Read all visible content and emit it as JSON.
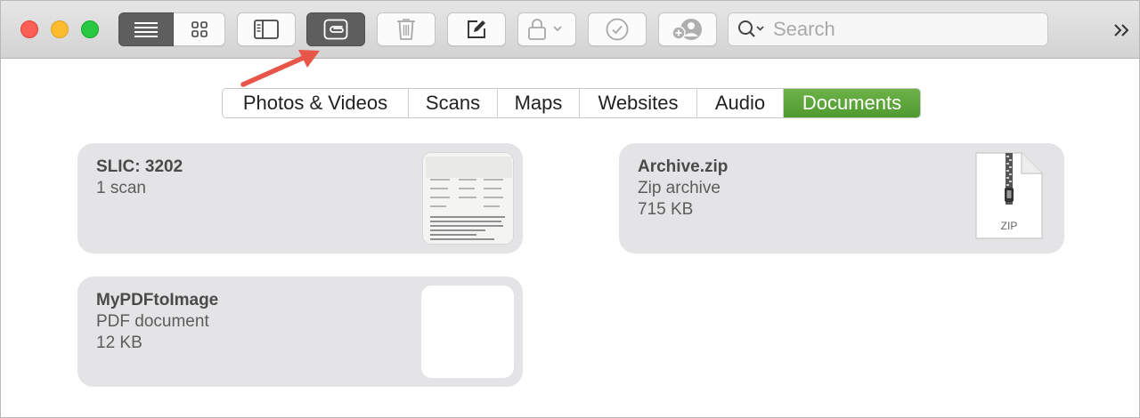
{
  "toolbar": {
    "view_buttons": [
      {
        "name": "list-view-button",
        "icon": "list-icon",
        "active": true
      },
      {
        "name": "grid-view-button",
        "icon": "grid-icon",
        "active": false
      }
    ],
    "sidebar_button_icon": "sidebar-icon",
    "attachments_button_icon": "paperclip-icon",
    "delete_button_icon": "trash-icon",
    "compose_button_icon": "compose-icon",
    "lock_button_icon": "lock-icon",
    "checklist_button_icon": "checkmark-circle-icon",
    "collaborate_button_icon": "add-person-icon",
    "search": {
      "placeholder": "Search",
      "value": ""
    },
    "overflow_label": "»"
  },
  "tabs": [
    {
      "label": "Photos & Videos",
      "active": false
    },
    {
      "label": "Scans",
      "active": false
    },
    {
      "label": "Maps",
      "active": false
    },
    {
      "label": "Websites",
      "active": false
    },
    {
      "label": "Audio",
      "active": false
    },
    {
      "label": "Documents",
      "active": true
    }
  ],
  "cards": [
    {
      "title": "SLIC: 3202",
      "line1": "1 scan",
      "line2": "",
      "thumbnail": "scan"
    },
    {
      "title": "Archive.zip",
      "line1": "Zip archive",
      "line2": "715 KB",
      "thumbnail": "zip",
      "thumb_label": "ZIP"
    },
    {
      "title": "MyPDFtoImage",
      "line1": "PDF document",
      "line2": "12 KB",
      "thumbnail": "blank"
    }
  ],
  "colors": {
    "active_tab": "#5aa53a",
    "annotation_arrow": "#e8564a",
    "close": "#fd5f57",
    "minimize": "#fdbc2e",
    "zoom": "#28c840"
  }
}
